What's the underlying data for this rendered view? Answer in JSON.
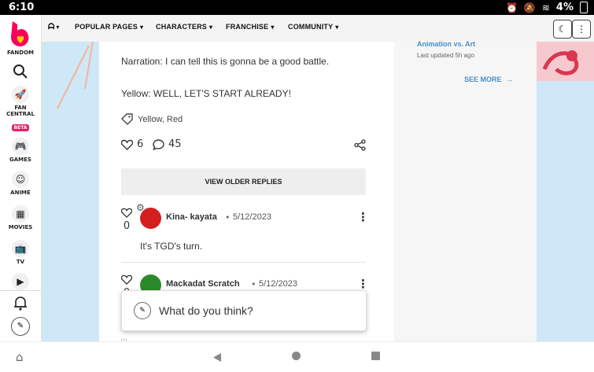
{
  "status_bar": {
    "time": "6:10",
    "battery": "4%"
  },
  "sidebar": {
    "items": [
      {
        "label": "FANDOM"
      },
      {
        "label": "FAN CENTRAL",
        "badge": "BETA"
      },
      {
        "label": "GAMES"
      },
      {
        "label": "ANIME"
      },
      {
        "label": "MOVIES"
      },
      {
        "label": "TV"
      }
    ]
  },
  "topnav": {
    "items": [
      {
        "label": "POPULAR PAGES"
      },
      {
        "label": "CHARACTERS"
      },
      {
        "label": "FRANCHISE"
      },
      {
        "label": "COMMUNITY"
      }
    ]
  },
  "rail": {
    "link_title": "Animation vs. Art",
    "last_updated": "Last updated 5h ago",
    "see_more": "SEE MORE"
  },
  "post": {
    "line1": "Narration: I can tell this is gonna be a good battle.",
    "line2": "Yellow: WELL, LET'S START ALREADY!",
    "tags": "Yellow, Red",
    "likes": "6",
    "comments": "45",
    "view_older": "VIEW OLDER REPLIES"
  },
  "replies": [
    {
      "user": "Kina- kayata",
      "date": "5/12/2023",
      "likes": "0",
      "text": "It's TGD's turn."
    },
    {
      "user": "Mackadat Scratch",
      "date": "5/12/2023",
      "likes": "0"
    }
  ],
  "composer": {
    "placeholder": "What do you think?"
  }
}
